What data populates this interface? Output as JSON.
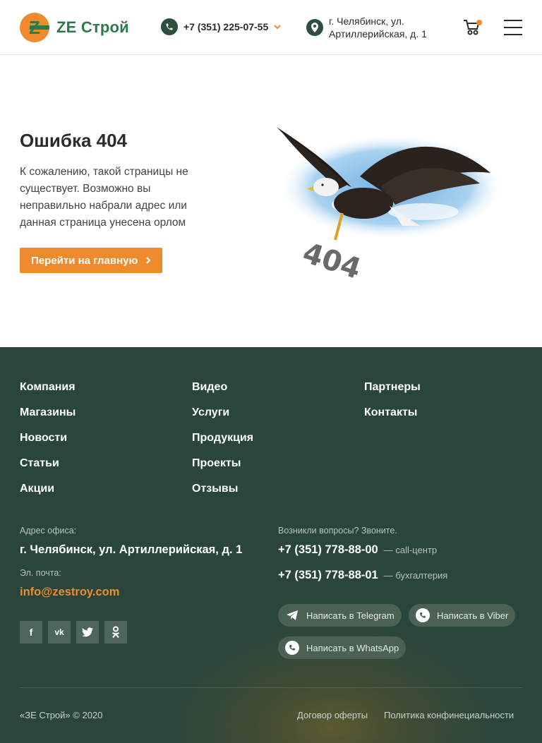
{
  "header": {
    "logo_text": "ZE Строй",
    "logo_letter": "Z",
    "phone": "+7 (351) 225-07-55",
    "address": "г. Челябинск, ул. Артиллерийская, д. 1",
    "icons": [
      "phone-icon",
      "chevron-down-icon",
      "location-icon",
      "cart-icon",
      "menu-icon"
    ]
  },
  "error": {
    "title": "Ошибка 404",
    "text": "К сожалению, такой страницы не существует. Возможно вы неправильно набрали адрес или данная страница унесена орлом",
    "button_label": "Перейти на главную",
    "image_text": "404"
  },
  "footer": {
    "nav_col1": [
      "Компания",
      "Магазины",
      "Новости",
      "Статьи",
      "Акции"
    ],
    "nav_col2": [
      "Видео",
      "Услуги",
      "Продукция",
      "Проекты",
      "Отзывы"
    ],
    "nav_col3": [
      "Партнеры",
      "Контакты"
    ],
    "office_label": "Адрес офиса:",
    "office_value": "г. Челябинск, ул. Артиллерийская, д. 1",
    "email_label": "Эл. почта:",
    "email_value": "info@zestroy.com",
    "questions_label": "Возникли вопросы? Звоните.",
    "phone1": "+7 (351) 778-88-00",
    "phone1_desc": "— call-центр",
    "phone2": "+7 (351) 778-88-01",
    "phone2_desc": "— бухгалтерия",
    "telegram_label": "Написать в Telegram",
    "viber_label": "Написать в Viber",
    "whatsapp_label": "Написать в WhatsApp",
    "social": [
      "facebook-icon",
      "vk-icon",
      "twitter-icon",
      "odnoklassniki-icon"
    ],
    "copyright": "«ЗЕ Строй» © 2020",
    "offer_link": "Договор оферты",
    "privacy_link": "Политика конфинециальности"
  },
  "colors": {
    "accent": "#ee8b2f",
    "brand_green": "#2c7a4a",
    "footer_bg": "#2a463b"
  }
}
